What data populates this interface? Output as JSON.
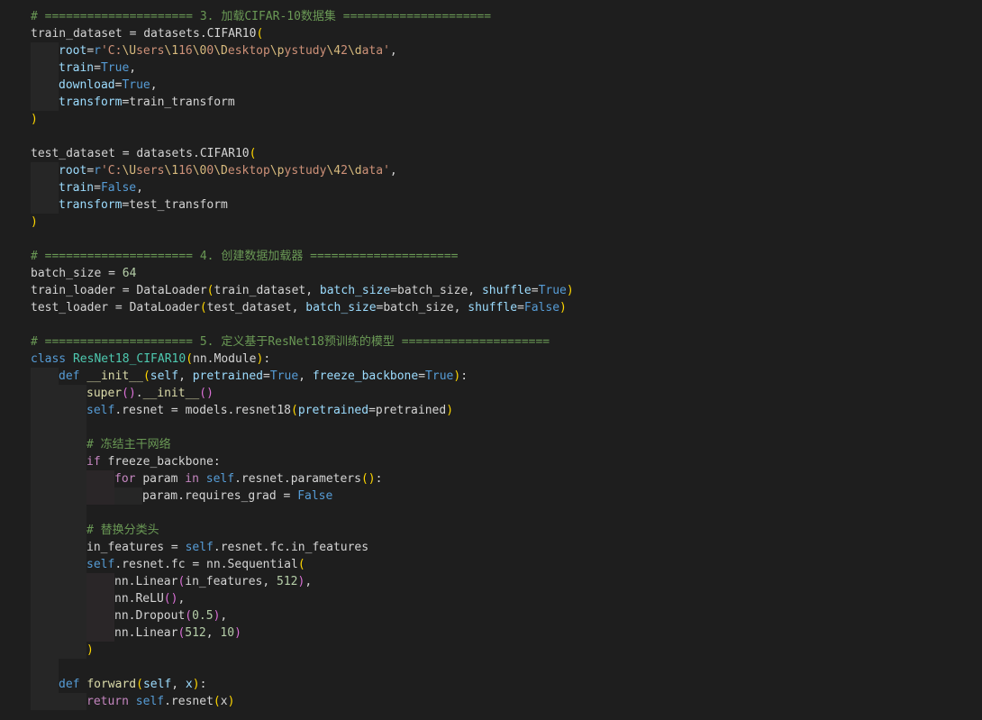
{
  "editor": {
    "language": "python",
    "theme": {
      "background": "#1e1e1e",
      "text": "#d4d4d4",
      "comment": "#6a9955",
      "keyword": "#c586c0",
      "constant": "#569cd6",
      "function": "#dcdcaa",
      "class": "#4ec9b0",
      "string": "#ce9178",
      "number": "#b5cea8",
      "parameter": "#9cdcfe",
      "bracket_1": "#ffd700",
      "bracket_2": "#da70d6"
    },
    "lines": [
      {
        "indent": 0,
        "tokens": [
          [
            "cmt",
            "# ===================== 3. 加载CIFAR-10数据集 ====================="
          ]
        ]
      },
      {
        "indent": 0,
        "tokens": [
          [
            "t",
            "train_dataset = datasets.CIFAR10"
          ],
          [
            "p1",
            "("
          ]
        ]
      },
      {
        "indent": 1,
        "tokens": [
          [
            "prm",
            "root"
          ],
          [
            "t",
            "="
          ],
          [
            "kwb",
            "r"
          ],
          [
            "str",
            "'C:"
          ],
          [
            "esc",
            "\\U"
          ],
          [
            "str",
            "sers"
          ],
          [
            "esc",
            "\\1"
          ],
          [
            "str",
            "16"
          ],
          [
            "esc",
            "\\0"
          ],
          [
            "str",
            "0"
          ],
          [
            "esc",
            "\\D"
          ],
          [
            "str",
            "esktop"
          ],
          [
            "esc",
            "\\p"
          ],
          [
            "str",
            "ystudy"
          ],
          [
            "esc",
            "\\4"
          ],
          [
            "str",
            "2"
          ],
          [
            "esc",
            "\\d"
          ],
          [
            "str",
            "ata'"
          ],
          [
            "t",
            ","
          ]
        ]
      },
      {
        "indent": 1,
        "tokens": [
          [
            "prm",
            "train"
          ],
          [
            "t",
            "="
          ],
          [
            "kwb",
            "True"
          ],
          [
            "t",
            ","
          ]
        ]
      },
      {
        "indent": 1,
        "tokens": [
          [
            "prm",
            "download"
          ],
          [
            "t",
            "="
          ],
          [
            "kwb",
            "True"
          ],
          [
            "t",
            ","
          ]
        ]
      },
      {
        "indent": 1,
        "tokens": [
          [
            "prm",
            "transform"
          ],
          [
            "t",
            "=train_transform"
          ]
        ]
      },
      {
        "indent": 0,
        "tokens": [
          [
            "p1",
            ")"
          ]
        ]
      },
      {
        "indent": 0,
        "tokens": []
      },
      {
        "indent": 0,
        "tokens": [
          [
            "t",
            "test_dataset = datasets.CIFAR10"
          ],
          [
            "p1",
            "("
          ]
        ]
      },
      {
        "indent": 1,
        "tokens": [
          [
            "prm",
            "root"
          ],
          [
            "t",
            "="
          ],
          [
            "kwb",
            "r"
          ],
          [
            "str",
            "'C:"
          ],
          [
            "esc",
            "\\U"
          ],
          [
            "str",
            "sers"
          ],
          [
            "esc",
            "\\1"
          ],
          [
            "str",
            "16"
          ],
          [
            "esc",
            "\\0"
          ],
          [
            "str",
            "0"
          ],
          [
            "esc",
            "\\D"
          ],
          [
            "str",
            "esktop"
          ],
          [
            "esc",
            "\\p"
          ],
          [
            "str",
            "ystudy"
          ],
          [
            "esc",
            "\\4"
          ],
          [
            "str",
            "2"
          ],
          [
            "esc",
            "\\d"
          ],
          [
            "str",
            "ata'"
          ],
          [
            "t",
            ","
          ]
        ]
      },
      {
        "indent": 1,
        "tokens": [
          [
            "prm",
            "train"
          ],
          [
            "t",
            "="
          ],
          [
            "kwb",
            "False"
          ],
          [
            "t",
            ","
          ]
        ]
      },
      {
        "indent": 1,
        "tokens": [
          [
            "prm",
            "transform"
          ],
          [
            "t",
            "=test_transform"
          ]
        ]
      },
      {
        "indent": 0,
        "tokens": [
          [
            "p1",
            ")"
          ]
        ]
      },
      {
        "indent": 0,
        "tokens": []
      },
      {
        "indent": 0,
        "tokens": [
          [
            "cmt",
            "# ===================== 4. 创建数据加载器 ====================="
          ]
        ]
      },
      {
        "indent": 0,
        "tokens": [
          [
            "t",
            "batch_size = "
          ],
          [
            "num",
            "64"
          ]
        ]
      },
      {
        "indent": 0,
        "tokens": [
          [
            "t",
            "train_loader = DataLoader"
          ],
          [
            "p1",
            "("
          ],
          [
            "t",
            "train_dataset, "
          ],
          [
            "prm",
            "batch_size"
          ],
          [
            "t",
            "=batch_size, "
          ],
          [
            "prm",
            "shuffle"
          ],
          [
            "t",
            "="
          ],
          [
            "kwb",
            "True"
          ],
          [
            "p1",
            ")"
          ]
        ]
      },
      {
        "indent": 0,
        "tokens": [
          [
            "t",
            "test_loader = DataLoader"
          ],
          [
            "p1",
            "("
          ],
          [
            "t",
            "test_dataset, "
          ],
          [
            "prm",
            "batch_size"
          ],
          [
            "t",
            "=batch_size, "
          ],
          [
            "prm",
            "shuffle"
          ],
          [
            "t",
            "="
          ],
          [
            "kwb",
            "False"
          ],
          [
            "p1",
            ")"
          ]
        ]
      },
      {
        "indent": 0,
        "tokens": []
      },
      {
        "indent": 0,
        "tokens": [
          [
            "cmt",
            "# ===================== 5. 定义基于ResNet18预训练的模型 ====================="
          ]
        ]
      },
      {
        "indent": 0,
        "tokens": [
          [
            "kwb",
            "class "
          ],
          [
            "cls",
            "ResNet18_CIFAR10"
          ],
          [
            "p1",
            "("
          ],
          [
            "t",
            "nn.Module"
          ],
          [
            "p1",
            ")"
          ],
          [
            "t",
            ":"
          ]
        ]
      },
      {
        "indent": 1,
        "tokens": [
          [
            "kwb",
            "def "
          ],
          [
            "fn",
            "__init__"
          ],
          [
            "p1",
            "("
          ],
          [
            "prm",
            "self"
          ],
          [
            "t",
            ", "
          ],
          [
            "prm",
            "pretrained"
          ],
          [
            "t",
            "="
          ],
          [
            "kwb",
            "True"
          ],
          [
            "t",
            ", "
          ],
          [
            "prm",
            "freeze_backbone"
          ],
          [
            "t",
            "="
          ],
          [
            "kwb",
            "True"
          ],
          [
            "p1",
            ")"
          ],
          [
            "t",
            ":"
          ]
        ]
      },
      {
        "indent": 2,
        "tokens": [
          [
            "fn",
            "super"
          ],
          [
            "p2",
            "()"
          ],
          [
            "t",
            "."
          ],
          [
            "fn",
            "__init__"
          ],
          [
            "p2",
            "()"
          ]
        ]
      },
      {
        "indent": 2,
        "tokens": [
          [
            "kwb",
            "self"
          ],
          [
            "t",
            ".resnet = models.resnet18"
          ],
          [
            "p1",
            "("
          ],
          [
            "prm",
            "pretrained"
          ],
          [
            "t",
            "=pretrained"
          ],
          [
            "p1",
            ")"
          ]
        ]
      },
      {
        "indent": 2,
        "tokens": []
      },
      {
        "indent": 2,
        "tokens": [
          [
            "cmt",
            "# 冻结主干网络"
          ]
        ]
      },
      {
        "indent": 2,
        "tokens": [
          [
            "kw",
            "if "
          ],
          [
            "t",
            "freeze_backbone:"
          ]
        ]
      },
      {
        "indent": 3,
        "tokens": [
          [
            "kw",
            "for "
          ],
          [
            "t",
            "param "
          ],
          [
            "kw",
            "in "
          ],
          [
            "kwb",
            "self"
          ],
          [
            "t",
            ".resnet.parameters"
          ],
          [
            "p1",
            "()"
          ],
          [
            "t",
            ":"
          ]
        ]
      },
      {
        "indent": 4,
        "tokens": [
          [
            "t",
            "param.requires_grad = "
          ],
          [
            "kwb",
            "False"
          ]
        ]
      },
      {
        "indent": 2,
        "tokens": []
      },
      {
        "indent": 2,
        "tokens": [
          [
            "cmt",
            "# 替换分类头"
          ]
        ]
      },
      {
        "indent": 2,
        "tokens": [
          [
            "t",
            "in_features = "
          ],
          [
            "kwb",
            "self"
          ],
          [
            "t",
            ".resnet.fc.in_features"
          ]
        ]
      },
      {
        "indent": 2,
        "tokens": [
          [
            "kwb",
            "self"
          ],
          [
            "t",
            ".resnet.fc = nn.Sequential"
          ],
          [
            "p1",
            "("
          ]
        ]
      },
      {
        "indent": 3,
        "tokens": [
          [
            "t",
            "nn.Linear"
          ],
          [
            "p2",
            "("
          ],
          [
            "t",
            "in_features, "
          ],
          [
            "num",
            "512"
          ],
          [
            "p2",
            ")"
          ],
          [
            "t",
            ","
          ]
        ]
      },
      {
        "indent": 3,
        "tokens": [
          [
            "t",
            "nn.ReLU"
          ],
          [
            "p2",
            "()"
          ],
          [
            "t",
            ","
          ]
        ]
      },
      {
        "indent": 3,
        "tokens": [
          [
            "t",
            "nn.Dropout"
          ],
          [
            "p2",
            "("
          ],
          [
            "num",
            "0.5"
          ],
          [
            "p2",
            ")"
          ],
          [
            "t",
            ","
          ]
        ]
      },
      {
        "indent": 3,
        "tokens": [
          [
            "t",
            "nn.Linear"
          ],
          [
            "p2",
            "("
          ],
          [
            "num",
            "512"
          ],
          [
            "t",
            ", "
          ],
          [
            "num",
            "10"
          ],
          [
            "p2",
            ")"
          ]
        ]
      },
      {
        "indent": 2,
        "tokens": [
          [
            "p1",
            ")"
          ]
        ]
      },
      {
        "indent": 1,
        "tokens": []
      },
      {
        "indent": 1,
        "tokens": [
          [
            "kwb",
            "def "
          ],
          [
            "fn",
            "forward"
          ],
          [
            "p1",
            "("
          ],
          [
            "prm",
            "self"
          ],
          [
            "t",
            ", "
          ],
          [
            "prm",
            "x"
          ],
          [
            "p1",
            ")"
          ],
          [
            "t",
            ":"
          ]
        ]
      },
      {
        "indent": 2,
        "tokens": [
          [
            "kw",
            "return "
          ],
          [
            "kwb",
            "self"
          ],
          [
            "t",
            ".resnet"
          ],
          [
            "p1",
            "("
          ],
          [
            "t",
            "x"
          ],
          [
            "p1",
            ")"
          ]
        ]
      }
    ]
  }
}
